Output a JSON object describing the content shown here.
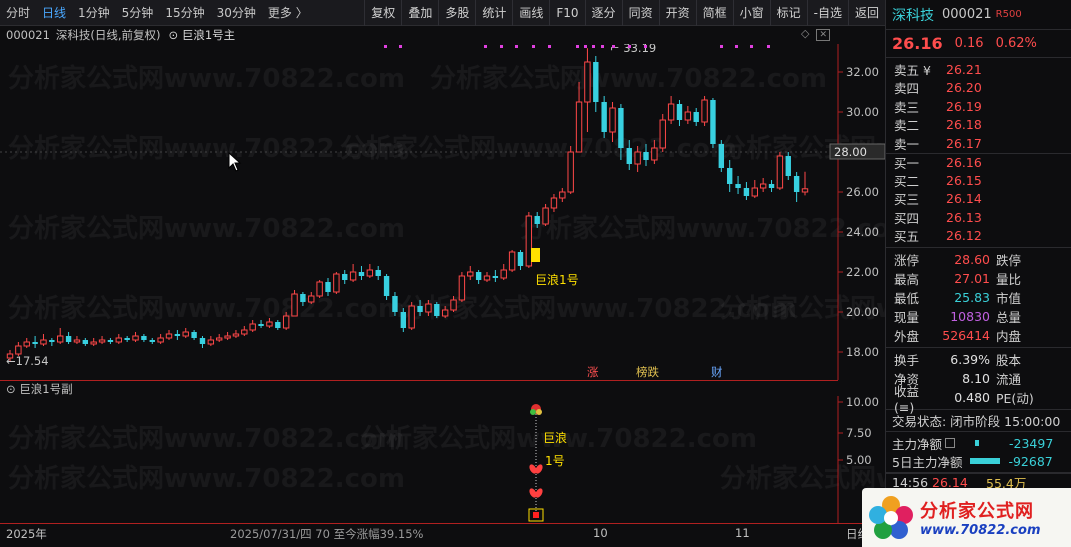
{
  "toolbar": {
    "periods": [
      "分时",
      "日线",
      "1分钟",
      "5分钟",
      "15分钟",
      "30分钟",
      "更多 〉"
    ],
    "active_index": 1,
    "buttons": [
      "复权",
      "叠加",
      "多股",
      "统计",
      "画线",
      "F10",
      "逐分",
      "同资",
      "开资",
      "简框",
      "小窗",
      "标记",
      "-自选",
      "返回"
    ]
  },
  "chart": {
    "code": "000021",
    "title": "深科技(日线,前复权)",
    "indicator_main": "巨浪1号主",
    "indicator_sub": "巨浪1号副",
    "high_label": "33.19",
    "low_label": "17.54",
    "signal_label": "巨浪1号",
    "sub_signal_line1": "巨浪",
    "sub_signal_line2": "1号",
    "current_price_tag": "28.00",
    "event_tags": [
      {
        "text": "涨",
        "color": "#ff5050"
      },
      {
        "text": "榜跌",
        "color": "#e0c050"
      },
      {
        "text": "财",
        "color": "#6aa8ff"
      }
    ],
    "y_ticks_main": [
      "32.00",
      "30.00",
      "28.00",
      "26.00",
      "24.00",
      "22.00",
      "20.00",
      "18.00"
    ],
    "y_ticks_sub": [
      "10.00",
      "7.50",
      "5.00"
    ],
    "x_labels": [
      "2025年",
      "10",
      "11",
      "日线"
    ],
    "info": "2025/07/31/四 70 至今涨幅39.15%",
    "watermark": "分析家公式网www.70822.com"
  },
  "panel": {
    "name": "深科技",
    "code": "000021",
    "rating": "R500",
    "price": "26.16",
    "change": "0.16",
    "change_pct": "0.62%",
    "asks": [
      {
        "label": "卖五 ¥",
        "price": "26.21"
      },
      {
        "label": "卖四",
        "price": "26.20"
      },
      {
        "label": "卖三",
        "price": "26.19"
      },
      {
        "label": "卖二",
        "price": "26.18"
      },
      {
        "label": "卖一",
        "price": "26.17"
      }
    ],
    "bids": [
      {
        "label": "买一",
        "price": "26.16"
      },
      {
        "label": "买二",
        "price": "26.15"
      },
      {
        "label": "买三",
        "price": "26.14"
      },
      {
        "label": "买四",
        "price": "26.13"
      },
      {
        "label": "买五",
        "price": "26.12"
      }
    ],
    "stats": [
      {
        "label": "涨停",
        "value": "28.60",
        "color": "red",
        "label2": "跌停"
      },
      {
        "label": "最高",
        "value": "27.01",
        "color": "red",
        "label2": "量比"
      },
      {
        "label": "最低",
        "value": "25.83",
        "color": "cyan",
        "label2": "市值"
      },
      {
        "label": "现量",
        "value": "10830",
        "color": "purple",
        "label2": "总量"
      },
      {
        "label": "外盘",
        "value": "526414",
        "color": "red",
        "label2": "内盘"
      }
    ],
    "stats2": [
      {
        "label": "换手",
        "value": "6.39%",
        "label2": "股本"
      },
      {
        "label": "净资",
        "value": "8.10",
        "label2": "流通"
      },
      {
        "label": "收益(≡)",
        "value": "0.480",
        "label2": "PE(动)"
      }
    ],
    "trade_status": "交易状态: 闭市阶段 15:00:00",
    "flow": [
      {
        "label": "主力净额",
        "value": "-23497"
      },
      {
        "label": "5日主力净额",
        "value": "-92687"
      }
    ],
    "ticks": [
      {
        "time": "14:56",
        "price": "26.14",
        "vol": "55.4万"
      }
    ]
  },
  "logo": {
    "line1": "分析家公式网",
    "line2": "www.70822.com"
  }
}
